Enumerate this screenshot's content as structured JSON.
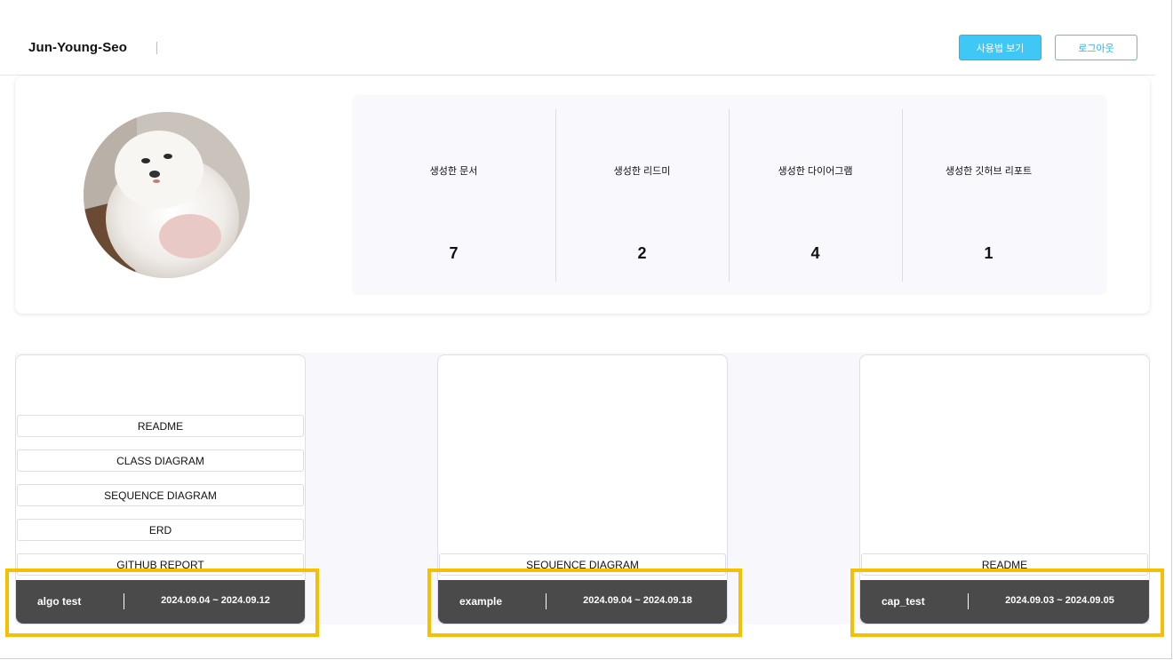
{
  "header": {
    "user_name": "Jun-Young-Seo",
    "guide_button": "사용법 보기",
    "logout_button": "로그아웃"
  },
  "stats": [
    {
      "label": "생성한 문서",
      "value": "7"
    },
    {
      "label": "생성한 리드미",
      "value": "2"
    },
    {
      "label": "생성한 다이어그램",
      "value": "4"
    },
    {
      "label": "생성한 깃허브 리포트",
      "value": "1"
    }
  ],
  "documents": [
    {
      "title": "algo test",
      "date_range": "2024.09.04 ~ 2024.09.12",
      "items": [
        "README",
        "CLASS DIAGRAM",
        "SEQUENCE DIAGRAM",
        "ERD",
        "GITHUB REPORT"
      ]
    },
    {
      "title": "example",
      "date_range": "2024.09.04 ~ 2024.09.18",
      "items": [
        "SEQUENCE DIAGRAM"
      ]
    },
    {
      "title": "cap_test",
      "date_range": "2024.09.03 ~ 2024.09.05",
      "items": [
        "README"
      ]
    }
  ],
  "colors": {
    "accent": "#3fc8f6",
    "footer": "#4a4a4a",
    "highlight": "#f5c000"
  }
}
